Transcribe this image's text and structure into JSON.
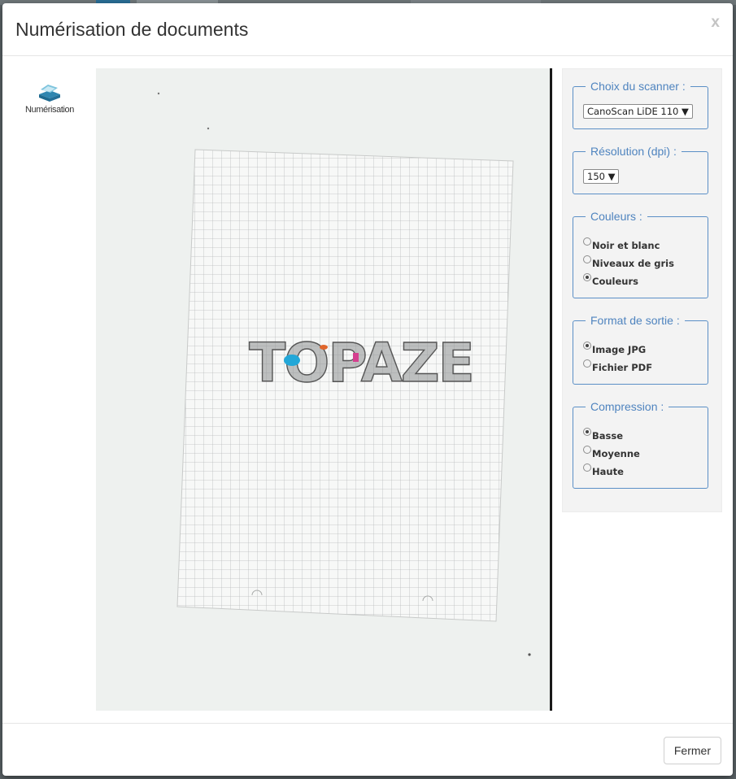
{
  "modal": {
    "title": "Numérisation de documents",
    "close_label": "x"
  },
  "toolbar": {
    "items": [
      {
        "icon": "scanner-icon",
        "label": "Numérisation"
      }
    ]
  },
  "preview": {
    "document_text": "TOPAZE"
  },
  "settings": {
    "scanner": {
      "legend": "Choix du scanner :",
      "selected": "CanoScan LiDE 110 ▼"
    },
    "resolution": {
      "legend": "Résolution (dpi) :",
      "selected": "150 ▼"
    },
    "colors": {
      "legend": "Couleurs :",
      "options": [
        {
          "label": "Noir et blanc",
          "checked": false
        },
        {
          "label": "Niveaux de gris",
          "checked": false
        },
        {
          "label": "Couleurs",
          "checked": true
        }
      ]
    },
    "format": {
      "legend": "Format de sortie :",
      "options": [
        {
          "label": "Image JPG",
          "checked": true
        },
        {
          "label": "Fichier PDF",
          "checked": false
        }
      ]
    },
    "compression": {
      "legend": "Compression :",
      "options": [
        {
          "label": "Basse",
          "checked": true
        },
        {
          "label": "Moyenne",
          "checked": false
        },
        {
          "label": "Haute",
          "checked": false
        }
      ]
    }
  },
  "footer": {
    "close_button": "Fermer"
  },
  "colors": {
    "accent": "#4f84bf",
    "fieldset_border": "#5b8fc6",
    "panel_bg": "#f3f3f3"
  }
}
